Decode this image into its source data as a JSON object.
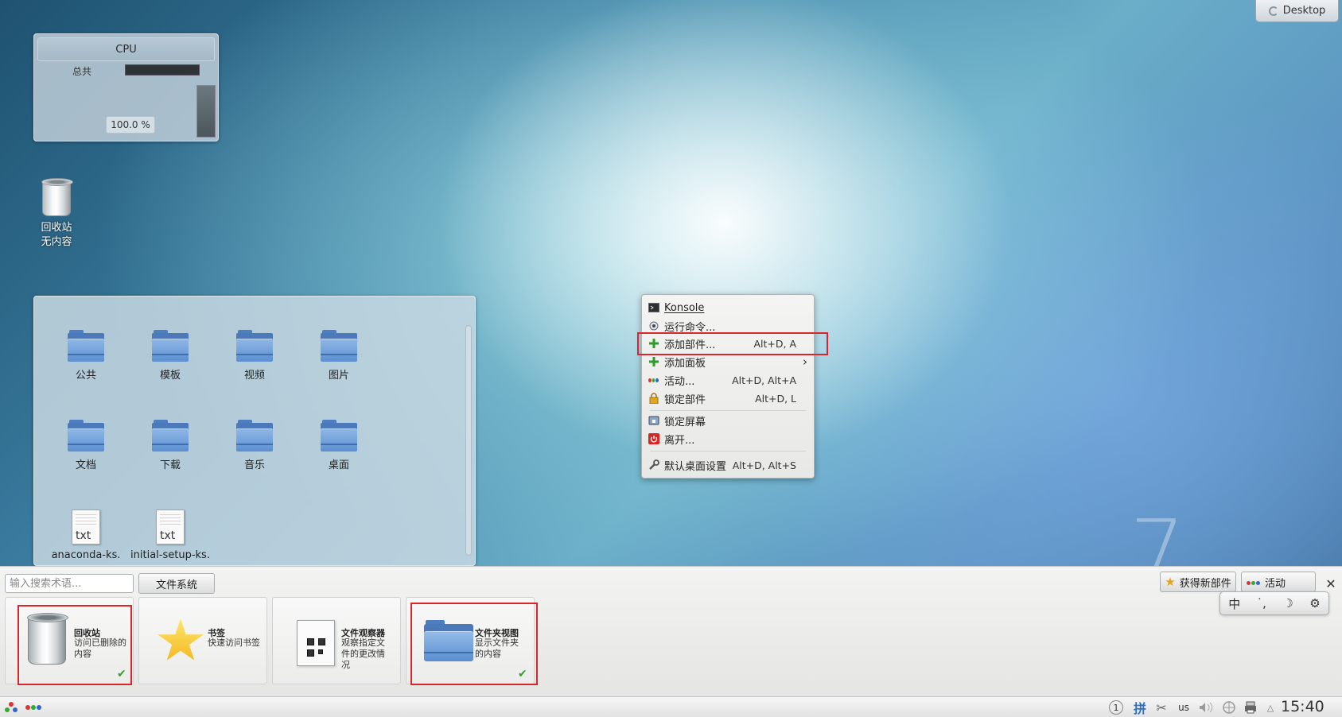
{
  "desktop": {
    "toolbox_label": "Desktop",
    "wallpaper_glyph": "7"
  },
  "cpu_widget": {
    "title": "CPU",
    "total_label": "总共",
    "percent": "100.0 %"
  },
  "desktop_icons": {
    "trash": {
      "name": "回收站",
      "status": "无内容"
    }
  },
  "folder_view": {
    "items": [
      {
        "label": "公共",
        "type": "folder"
      },
      {
        "label": "模板",
        "type": "folder"
      },
      {
        "label": "视频",
        "type": "folder"
      },
      {
        "label": "图片",
        "type": "folder"
      },
      {
        "label": "文档",
        "type": "folder"
      },
      {
        "label": "下载",
        "type": "folder"
      },
      {
        "label": "音乐",
        "type": "folder"
      },
      {
        "label": "桌面",
        "type": "folder"
      },
      {
        "label": "anaconda-ks.",
        "type": "txt"
      },
      {
        "label": "initial-setup-ks.",
        "type": "txt"
      }
    ],
    "file_ext": "txt"
  },
  "context_menu": {
    "items": [
      {
        "label": "Konsole",
        "shortcut": "",
        "icon": "terminal-icon"
      },
      {
        "label": "运行命令...",
        "shortcut": "",
        "icon": "run-command-icon"
      },
      {
        "label": "添加部件...",
        "shortcut": "Alt+D, A",
        "icon": "add-icon"
      },
      {
        "label": "添加面板",
        "shortcut": "",
        "icon": "add-icon",
        "submenu": true
      },
      {
        "label": "活动...",
        "shortcut": "Alt+D, Alt+A",
        "icon": "activities-icon"
      },
      {
        "label": "锁定部件",
        "shortcut": "Alt+D, L",
        "icon": "lock-icon"
      },
      {
        "label": "锁定屏幕",
        "shortcut": "",
        "icon": "lock-screen-icon"
      },
      {
        "label": "离开...",
        "shortcut": "",
        "icon": "leave-icon"
      },
      {
        "label": "默认桌面设置",
        "shortcut": "Alt+D, Alt+S",
        "icon": "wrench-icon"
      }
    ],
    "submenu_arrow": "›"
  },
  "widget_explorer": {
    "search_placeholder": "输入搜索术语...",
    "filter_button": "文件系统",
    "get_new_button": "获得新部件",
    "activities_button": "活动",
    "close_glyph": "✕",
    "widgets": [
      {
        "title": "回收站",
        "desc": "访问已删除的内容",
        "installed": true
      },
      {
        "title": "书签",
        "desc": "快速访问书签",
        "installed": false
      },
      {
        "title": "文件观察器",
        "desc": "观察指定文件的更改情况",
        "installed": false
      },
      {
        "title": "文件夹视图",
        "desc": "显示文件夹的内容",
        "installed": true
      }
    ],
    "check_glyph": "✔"
  },
  "quick_bar": {
    "input_method": "中",
    "punct": "˙,",
    "moon": "☽",
    "gear": "⚙"
  },
  "taskbar": {
    "tray": {
      "notifications": "1",
      "pinyin": "拼",
      "keyboard_layout": "us",
      "up_arrow": "△"
    },
    "clock": "15:40"
  },
  "colors": {
    "highlight": "#d8262c",
    "check": "#3a9c2e",
    "folder_blue": "#5b8fd0"
  }
}
